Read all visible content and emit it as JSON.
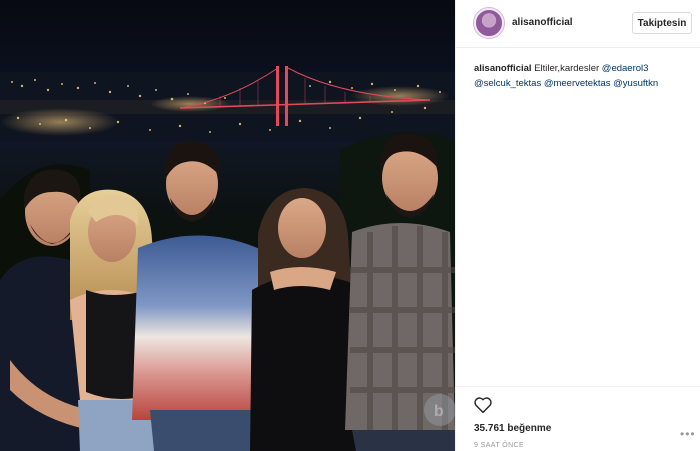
{
  "post": {
    "username": "alisanofficial",
    "follow_label": "Takiptesin",
    "caption": {
      "username": "alisanofficial",
      "text": "Eltiler,kardesler",
      "emoji": "⁡⁡",
      "mentions": [
        "@edaerol3",
        "@selcuk_tektas",
        "@meervetektas",
        "@yusuftkn"
      ]
    },
    "likes": "35.761 beğenme",
    "time_ago": "9 SAAT ÖNCE"
  },
  "icons": {
    "like": "heart-outline-icon",
    "options": "more-options-icon",
    "avatar": "profile-avatar"
  },
  "colors": {
    "bridge_lights": "#e24a5a",
    "border": "#efefef",
    "mention": "#003569",
    "muted": "#999999"
  }
}
